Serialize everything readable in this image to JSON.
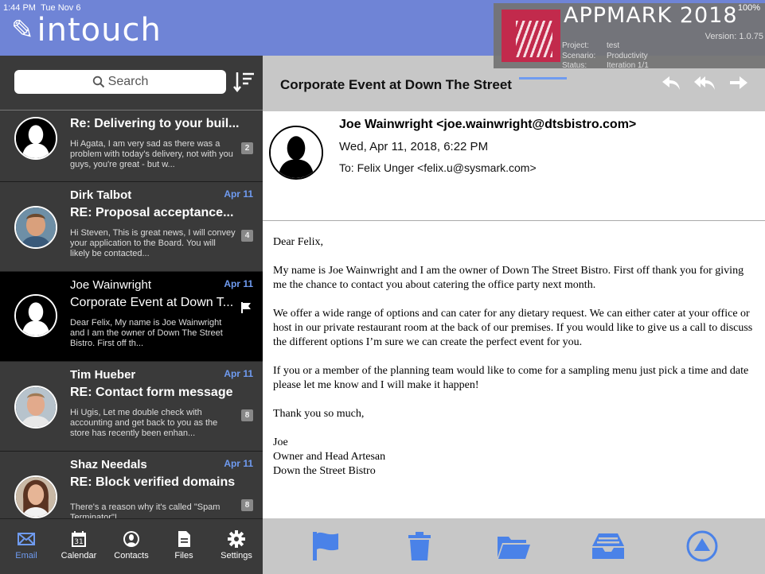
{
  "status": {
    "time": "1:44 PM",
    "date": "Tue Nov 6",
    "battery": "100%"
  },
  "app": {
    "name": "intouch",
    "logo_mark": "✎"
  },
  "appmark": {
    "title": "APPMARK 2018",
    "version": "Version: 1.0.75",
    "project_label": "Project:",
    "project": "test",
    "scenario_label": "Scenario:",
    "scenario": "Productivity",
    "status_label": "Status:",
    "status": "Iteration 1/1"
  },
  "search": {
    "placeholder": "Search"
  },
  "messages": [
    {
      "sender": "",
      "date": "",
      "subject": "Re: Delivering to your buil...",
      "preview": "Hi Agata, I am very sad as there was a problem with today's delivery, not with you guys, you're great - but w...",
      "count": "2",
      "avatar": "silhouette"
    },
    {
      "sender": "Dirk Talbot",
      "date": "Apr 11",
      "subject": "RE: Proposal acceptance...",
      "preview": "Hi Steven, This is great news, I will convey your application to the Board. You will likely be contacted...",
      "count": "4",
      "avatar": "photo-man-1"
    },
    {
      "sender": "Joe Wainwright",
      "date": "Apr 11",
      "subject": "Corporate Event at Down T...",
      "preview": "Dear Felix, My name is Joe Wainwright and I am the owner of Down The Street Bistro. First off th...",
      "count": "",
      "avatar": "silhouette"
    },
    {
      "sender": "Tim Hueber",
      "date": "Apr 11",
      "subject": "RE: Contact form message",
      "preview": "Hi Ugis, Let me double check with accounting and get back to you as the store has recently been enhan...",
      "count": "8",
      "avatar": "photo-man-2"
    },
    {
      "sender": "Shaz Needals",
      "date": "Apr 11",
      "subject": "RE: Block verified domains",
      "preview": "There's a reason why it's called \"Spam Terminator\"!",
      "count": "8",
      "avatar": "photo-woman"
    }
  ],
  "tabs": [
    {
      "label": "Email",
      "icon": "envelope-icon"
    },
    {
      "label": "Calendar",
      "icon": "calendar-icon"
    },
    {
      "label": "Contacts",
      "icon": "contact-icon"
    },
    {
      "label": "Files",
      "icon": "file-icon"
    },
    {
      "label": "Settings",
      "icon": "gear-icon"
    }
  ],
  "email": {
    "subject": "Corporate Event at Down The Street",
    "from": "Joe Wainwright <joe.wainwright@dtsbistro.com>",
    "date": "Wed, Apr 11, 2018, 6:22 PM",
    "to": "To: Felix Unger <felix.u@sysmark.com>",
    "greeting": "Dear Felix,",
    "paragraphs": [
      "My name is Joe Wainwright and I am the owner of Down The Street Bistro. First off thank you for giving me the chance to contact you about catering the office party next month.",
      "We offer a wide range of options and can cater for any dietary request. We can either cater at your office or host in our private restaurant room at the back of our premises. If you would like to give us a call to discuss the different options I’m sure we can create the perfect event for you.",
      "If you or a member of the planning team would like to come for a sampling menu just pick a time and date please let me know and I will make it happen!",
      "Thank you so much,"
    ],
    "signature": [
      "Joe",
      "Owner and Head Artesan",
      "Down the Street Bistro"
    ]
  },
  "colors": {
    "header": "#6f84d6",
    "accent": "#6f9bf0",
    "icon_blue": "#4a82e8"
  }
}
